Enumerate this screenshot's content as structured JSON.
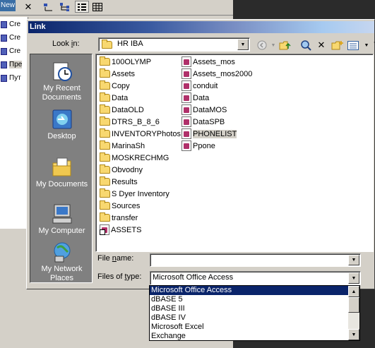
{
  "background_app": {
    "new_label": "New",
    "list_items": [
      "Cre",
      "Cre",
      "Cre",
      "Пре",
      "Пут"
    ]
  },
  "dialog": {
    "title": "Link",
    "look_in_label_prefix": "Look ",
    "look_in_label_underlined": "i",
    "look_in_label_suffix": "n:",
    "look_in_value": "HR IBA",
    "places": [
      {
        "label": "My Recent Documents",
        "icon": "recent-documents-icon"
      },
      {
        "label": "Desktop",
        "icon": "desktop-icon"
      },
      {
        "label": "My Documents",
        "icon": "my-documents-icon"
      },
      {
        "label": "My Computer",
        "icon": "my-computer-icon"
      },
      {
        "label": "My Network Places",
        "icon": "network-places-icon"
      }
    ],
    "folders": [
      "100OLYMP",
      "Assets",
      "Copy",
      "Data",
      "DataOLD",
      "DTRS_B_8_6",
      "INVENTORYPhotos",
      "MarinaSh",
      "MOSKRECHMG",
      "Obvodny",
      "Results",
      "S Dyer Inventory",
      "Sources",
      "transfer"
    ],
    "col1_files": [
      "ASSETS"
    ],
    "col2_files": [
      "Assets_mos",
      "Assets_mos2000",
      "conduit",
      "Data",
      "DataMOS",
      "DataSPB",
      "PHONELIST",
      "Ppone"
    ],
    "file_name_label_prefix": "File ",
    "file_name_label_underlined": "n",
    "file_name_label_suffix": "ame:",
    "file_name_value": "",
    "files_of_type_label_prefix": "Files of ",
    "files_of_type_label_underlined": "t",
    "files_of_type_label_suffix": "ype:",
    "files_of_type_value": "Microsoft Office Access",
    "type_options": [
      "Microsoft Office Access",
      "dBASE 5",
      "dBASE III",
      "dBASE IV",
      "Microsoft Excel",
      "Exchange"
    ],
    "selected_type_index": 0
  }
}
